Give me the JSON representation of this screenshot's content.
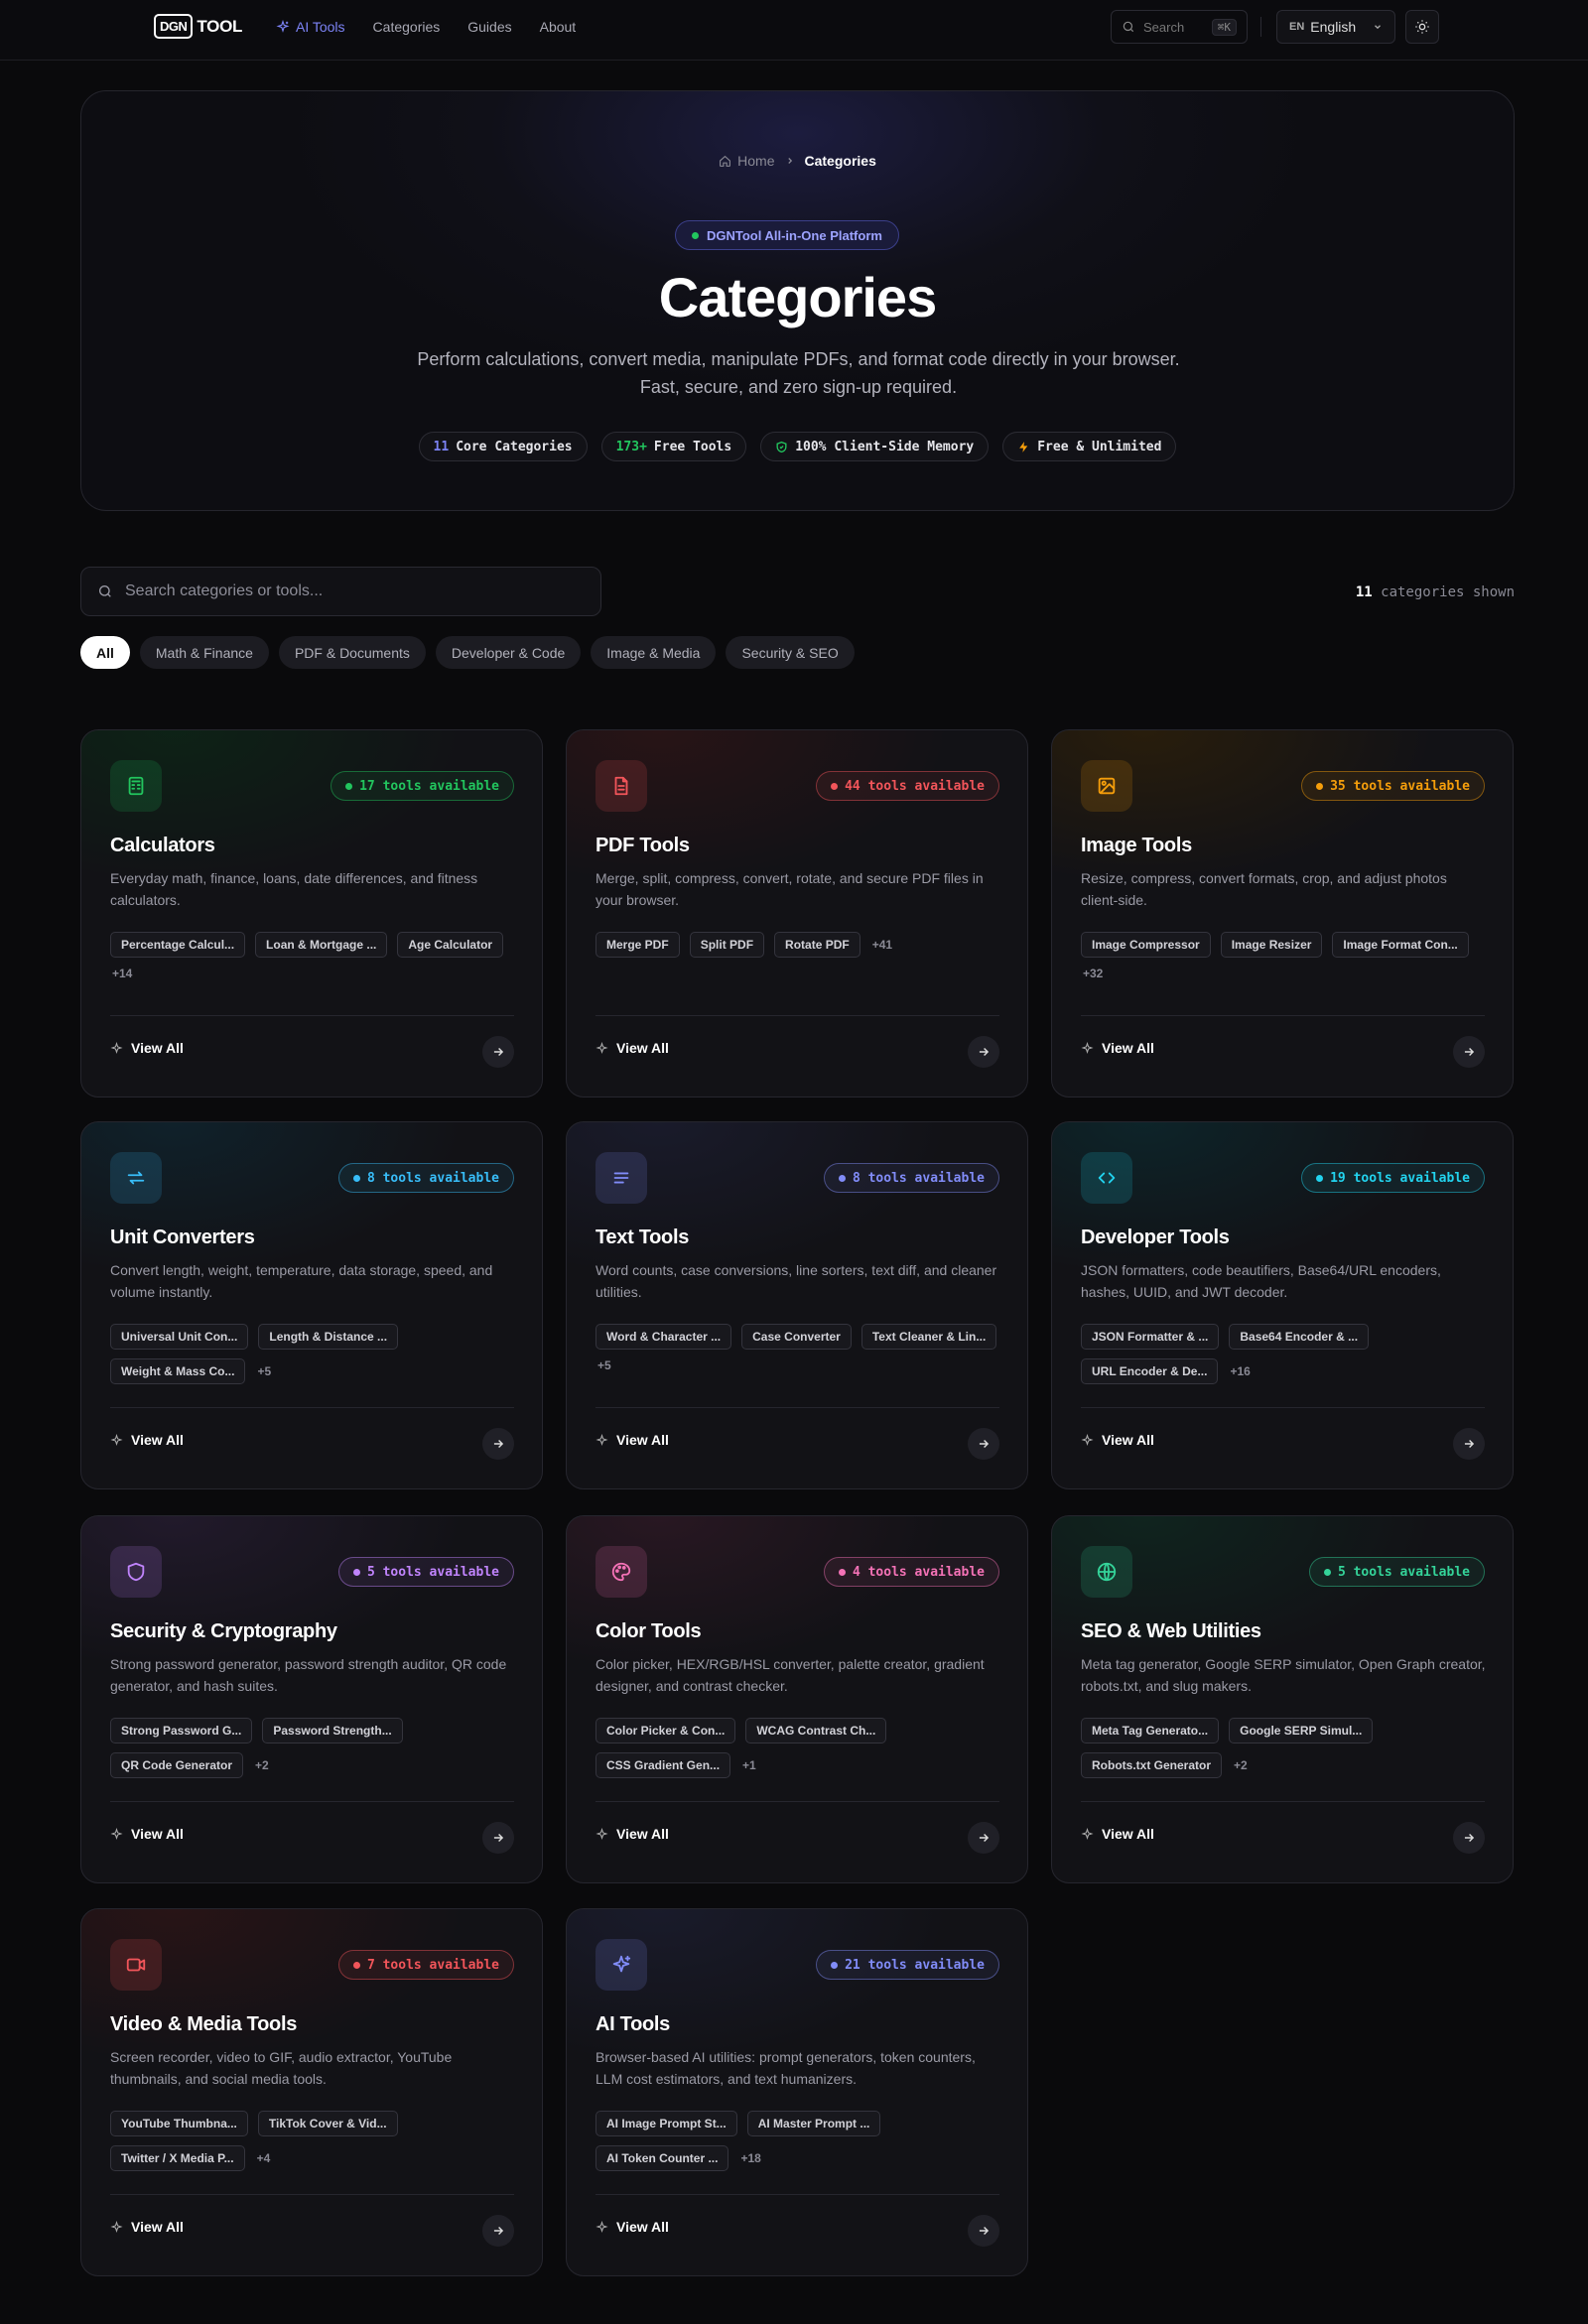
{
  "nav": {
    "logo_box": "DGN",
    "logo_text": "TOOL",
    "links": [
      "AI Tools",
      "Categories",
      "Guides",
      "About"
    ],
    "search_label": "Search",
    "search_kbd": "⌘K",
    "lang_code": "EN",
    "lang_label": "English"
  },
  "hero": {
    "breadcrumb": [
      "Home",
      "Categories"
    ],
    "platform_label": "DGNTool All-in-One Platform",
    "title": "Categories",
    "subtitle": "Perform calculations, convert media, manipulate PDFs, and format code directly in your browser. Fast, secure, and zero sign-up required.",
    "pills": [
      {
        "num": "11",
        "text": "Core Categories"
      },
      {
        "num": "173+",
        "text": "Free Tools"
      },
      {
        "num": "",
        "text": "100% Client-Side Memory"
      },
      {
        "num": "",
        "text": "Free & Unlimited"
      }
    ]
  },
  "search": {
    "placeholder": "Search categories or tools...",
    "count_num": "11",
    "count_text": "categories shown"
  },
  "filters": [
    "All",
    "Math & Finance",
    "PDF & Documents",
    "Developer & Code",
    "Image & Media",
    "Security & SEO"
  ],
  "view_all": "View All",
  "cards": [
    {
      "title": "Calculators",
      "badge": "17 tools available",
      "color": "#22c55e",
      "icon": "calculator-icon",
      "desc": "Everyday math, finance, loans, date differences, and fitness calculators.",
      "tags": [
        "Percentage Calcul...",
        "Loan & Mortgage ...",
        "Age Calculator"
      ],
      "more": "+14"
    },
    {
      "title": "PDF Tools",
      "badge": "44 tools available",
      "color": "#f2555a",
      "icon": "file-text-icon",
      "desc": "Merge, split, compress, convert, rotate, and secure PDF files in your browser.",
      "tags": [
        "Merge PDF",
        "Split PDF",
        "Rotate PDF"
      ],
      "more": "+41"
    },
    {
      "title": "Image Tools",
      "badge": "35 tools available",
      "color": "#f59e0b",
      "icon": "image-icon",
      "desc": "Resize, compress, convert formats, crop, and adjust photos client-side.",
      "tags": [
        "Image Compressor",
        "Image Resizer",
        "Image Format Con..."
      ],
      "more": "+32"
    },
    {
      "title": "Unit Converters",
      "badge": "8 tools available",
      "color": "#38bdf8",
      "icon": "swap-arrows-icon",
      "desc": "Convert length, weight, temperature, data storage, speed, and volume instantly.",
      "tags": [
        "Universal Unit Con...",
        "Length & Distance ...",
        "Weight & Mass Co..."
      ],
      "more": "+5"
    },
    {
      "title": "Text Tools",
      "badge": "8 tools available",
      "color": "#818cf8",
      "icon": "text-lines-icon",
      "desc": "Word counts, case conversions, line sorters, text diff, and cleaner utilities.",
      "tags": [
        "Word & Character ...",
        "Case Converter",
        "Text Cleaner & Lin..."
      ],
      "more": "+5"
    },
    {
      "title": "Developer Tools",
      "badge": "19 tools available",
      "color": "#22d3ee",
      "icon": "code-icon",
      "desc": "JSON formatters, code beautifiers, Base64/URL encoders, hashes, UUID, and JWT decoder.",
      "tags": [
        "JSON Formatter & ...",
        "Base64 Encoder & ...",
        "URL Encoder & De..."
      ],
      "more": "+16"
    },
    {
      "title": "Security & Cryptography",
      "badge": "5 tools available",
      "color": "#c084fc",
      "icon": "shield-icon",
      "desc": "Strong password generator, password strength auditor, QR code generator, and hash suites.",
      "tags": [
        "Strong Password G...",
        "Password Strength...",
        "QR Code Generator"
      ],
      "more": "+2"
    },
    {
      "title": "Color Tools",
      "badge": "4 tools available",
      "color": "#f472b6",
      "icon": "palette-icon",
      "desc": "Color picker, HEX/RGB/HSL converter, palette creator, gradient designer, and contrast checker.",
      "tags": [
        "Color Picker & Con...",
        "WCAG Contrast Ch...",
        "CSS Gradient Gen..."
      ],
      "more": "+1"
    },
    {
      "title": "SEO & Web Utilities",
      "badge": "5 tools available",
      "color": "#34d399",
      "icon": "globe-icon",
      "desc": "Meta tag generator, Google SERP simulator, Open Graph creator, robots.txt, and slug makers.",
      "tags": [
        "Meta Tag Generato...",
        "Google SERP Simul...",
        "Robots.txt Generator"
      ],
      "more": "+2"
    },
    {
      "title": "Video & Media Tools",
      "badge": "7 tools available",
      "color": "#f2555a",
      "icon": "video-icon",
      "desc": "Screen recorder, video to GIF, audio extractor, YouTube thumbnails, and social media tools.",
      "tags": [
        "YouTube Thumbna...",
        "TikTok Cover & Vid...",
        "Twitter / X Media P..."
      ],
      "more": "+4"
    },
    {
      "title": "AI Tools",
      "badge": "21 tools available",
      "color": "#818cf8",
      "icon": "sparkles-icon",
      "desc": "Browser-based AI utilities: prompt generators, token counters, LLM cost estimators, and text humanizers.",
      "tags": [
        "AI Image Prompt St...",
        "AI Master Prompt ...",
        "AI Token Counter ..."
      ],
      "more": "+18"
    }
  ]
}
